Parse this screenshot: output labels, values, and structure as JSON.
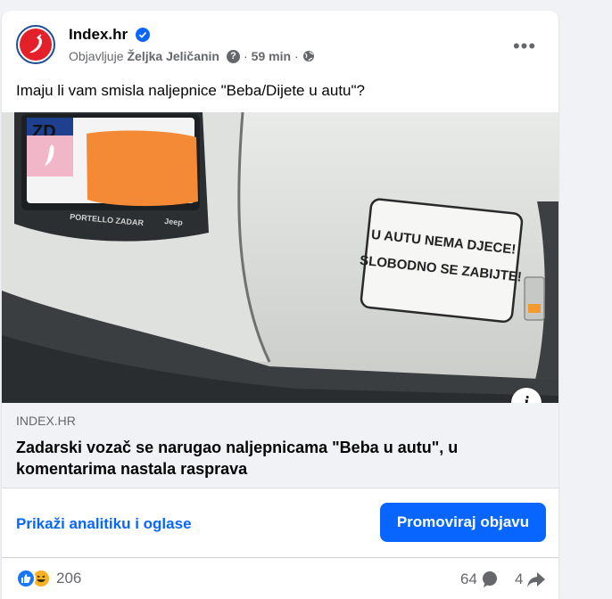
{
  "post": {
    "page_name": "Index.hr",
    "published_by_prefix": "Objavljuje",
    "author": "Željka Jeličanin",
    "separator": "·",
    "time": "59 min",
    "text": "Imaju li vam smisla naljepnice \"Beba/Dijete u autu\"?"
  },
  "image": {
    "sticker_line1": "U AUTU NEMA DJECE!",
    "sticker_line2": "SLOBODNO SE ZABIJTE!",
    "plate_frame_text": "PORTELLO ZADAR",
    "plate_letters": "ZD",
    "jeep_text": "Jeep",
    "info_label": "i"
  },
  "link": {
    "domain": "INDEX.HR",
    "title": "Zadarski vozač se narugao naljepnicama \"Beba u autu\", u komentarima nastala rasprava"
  },
  "actions": {
    "analytics_label": "Prikaži analitiku i oglase",
    "promote_label": "Promoviraj objavu"
  },
  "stats": {
    "reactions_count": "206",
    "comments_count": "64",
    "shares_count": "4"
  },
  "colors": {
    "brand_blue": "#0866ff",
    "secondary_text": "#65676b",
    "index_red": "#e4202a"
  },
  "icons": [
    "index-logo-icon",
    "verified-icon",
    "help-icon",
    "globe-icon",
    "more-icon",
    "info-icon",
    "like-icon",
    "haha-icon",
    "comment-icon",
    "share-icon"
  ]
}
